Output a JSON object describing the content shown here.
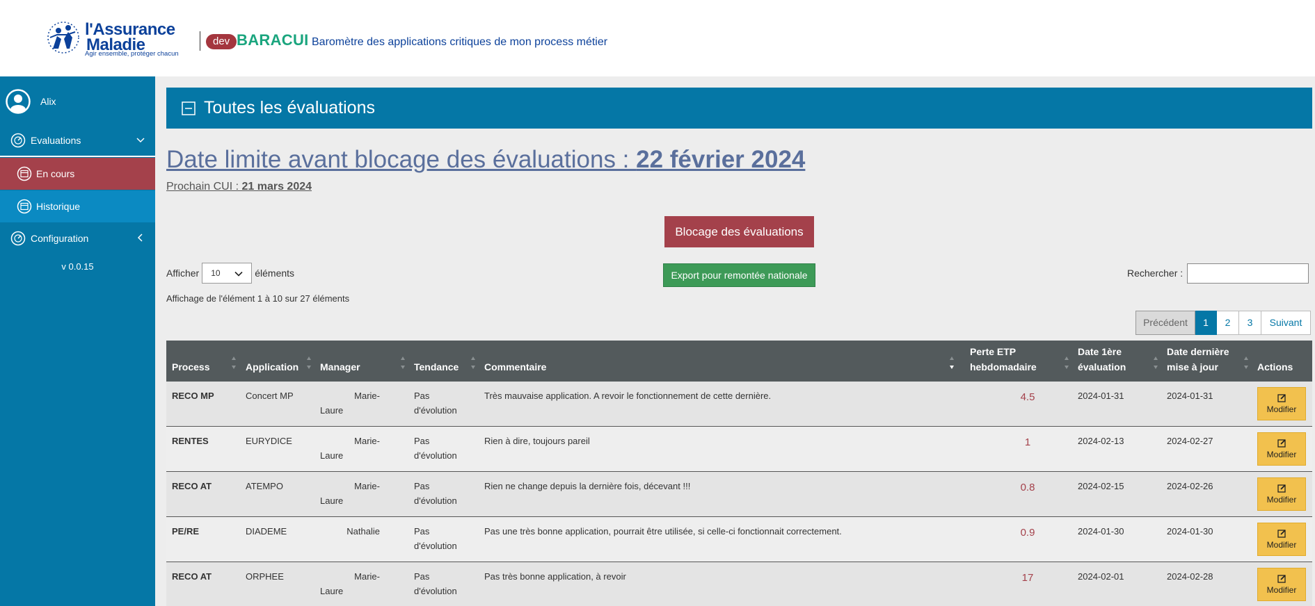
{
  "header": {
    "logo_line1": "l'Assurance",
    "logo_line2": "Maladie",
    "logo_tagline": "Agir ensemble, protéger chacun",
    "env_badge": "dev",
    "app_name": "BARACUI",
    "app_subtitle": "Baromètre des applications critiques de mon process métier"
  },
  "sidebar": {
    "user_name": "Alix",
    "items": [
      {
        "label": "Evaluations"
      },
      {
        "label": "En cours"
      },
      {
        "label": "Historique"
      },
      {
        "label": "Configuration"
      }
    ],
    "version": "v 0.0.15"
  },
  "panel": {
    "title": "Toutes les évaluations"
  },
  "deadline": {
    "label": "Date limite avant blocage des évaluations : ",
    "date": "22 février 2024"
  },
  "next_cui": {
    "label": "Prochain CUI : ",
    "date": "21 mars 2024"
  },
  "buttons": {
    "block": "Blocage des évaluations",
    "export": "Export pour remontée nationale"
  },
  "length_menu": {
    "before": "Afficher",
    "value": "10",
    "after": "éléments"
  },
  "search": {
    "label": "Rechercher :"
  },
  "info": "Affichage de l'élément 1 à 10 sur 27 éléments",
  "pager": {
    "prev": "Précédent",
    "pages": [
      "1",
      "2",
      "3"
    ],
    "next": "Suivant"
  },
  "table": {
    "columns": [
      {
        "label": "Process"
      },
      {
        "label": "Application"
      },
      {
        "label": "Manager"
      },
      {
        "label": "Tendance"
      },
      {
        "label": "Commentaire"
      },
      {
        "label1": "Perte ETP",
        "label2": "hebdomadaire"
      },
      {
        "label1": "Date 1ère",
        "label2": "évaluation"
      },
      {
        "label1": "Date dernière",
        "label2": "mise à jour"
      },
      {
        "label": "Actions"
      }
    ],
    "rows": [
      {
        "process": "RECO MP",
        "application": "Concert MP",
        "manager1": "Marie-",
        "manager2": "Laure",
        "tendance1": "Pas",
        "tendance2": "d'évolution",
        "commentaire": "Très mauvaise application. A revoir le fonctionnement de cette dernière.",
        "perte": "4.5",
        "date1": "2024-01-31",
        "date2": "2024-01-31",
        "action": "Modifier"
      },
      {
        "process": "RENTES",
        "application": "EURYDICE",
        "manager1": "Marie-",
        "manager2": "Laure",
        "tendance1": "Pas",
        "tendance2": "d'évolution",
        "commentaire": "Rien à dire, toujours pareil",
        "perte": "1",
        "date1": "2024-02-13",
        "date2": "2024-02-27",
        "action": "Modifier"
      },
      {
        "process": "RECO AT",
        "application": "ATEMPO",
        "manager1": "Marie-",
        "manager2": "Laure",
        "tendance1": "Pas",
        "tendance2": "d'évolution",
        "commentaire": "Rien ne change depuis la dernière fois, décevant !!!",
        "perte": "0.8",
        "date1": "2024-02-15",
        "date2": "2024-02-26",
        "action": "Modifier"
      },
      {
        "process": "PE/RE",
        "application": "DIADEME",
        "manager1": "Nathalie",
        "manager2": "",
        "tendance1": "Pas",
        "tendance2": "d'évolution",
        "commentaire": "Pas une très bonne application, pourrait être utilisée, si celle-ci fonctionnait correctement.",
        "perte": "0.9",
        "date1": "2024-01-30",
        "date2": "2024-01-30",
        "action": "Modifier"
      },
      {
        "process": "RECO AT",
        "application": "ORPHEE",
        "manager1": "Marie-",
        "manager2": "Laure",
        "tendance1": "Pas",
        "tendance2": "d'évolution",
        "commentaire": "Pas très bonne application, à revoir",
        "perte": "17",
        "date1": "2024-02-01",
        "date2": "2024-02-28",
        "action": "Modifier"
      }
    ]
  },
  "colors": {
    "primary": "#0577a6",
    "danger": "#a4414b",
    "success": "#3d9a57",
    "warning": "#f2c14e",
    "brand_green": "#1aa57e",
    "brand_blue": "#0c419a"
  }
}
